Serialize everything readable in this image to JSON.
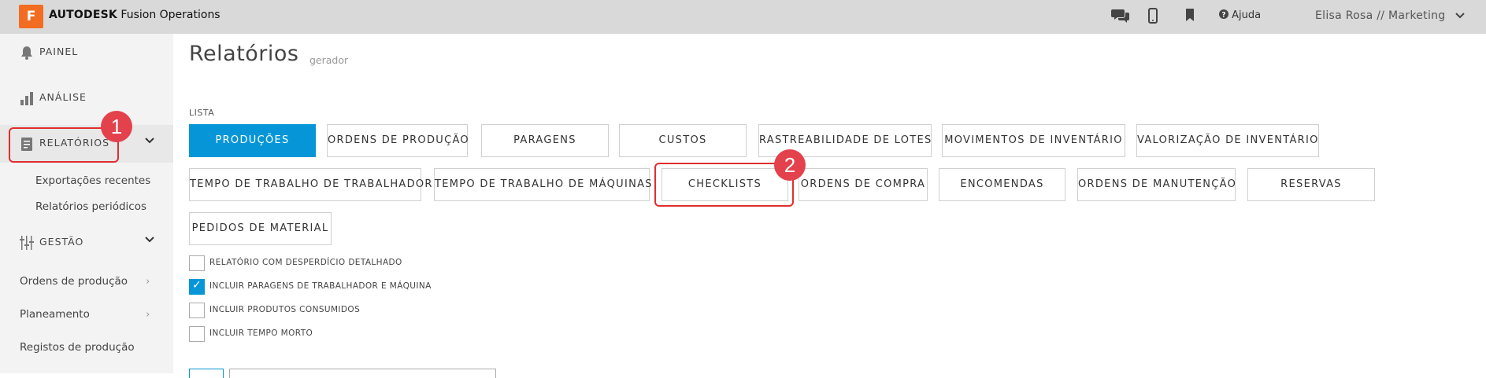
{
  "header": {
    "logo_letter": "F",
    "brand_bold": "AUTODESK",
    "brand_rest": "Fusion Operations",
    "help_label": "Ajuda",
    "user_label": "Elisa Rosa // Marketing"
  },
  "sidebar": {
    "nav": {
      "painel": "PAINEL",
      "analise": "ANÁLISE",
      "relatorios": "RELATÓRIOS",
      "gestao": "GESTÃO"
    },
    "relatorios_sub": {
      "recent": "Exportações recentes",
      "periodic": "Relatórios periódicos"
    },
    "gestao_sub": {
      "orders": "Ordens de produção",
      "planning": "Planeamento",
      "records": "Registos de produção"
    }
  },
  "page": {
    "title": "Relatórios",
    "subtitle": "gerador",
    "list_label": "LISTA"
  },
  "report_buttons": {
    "producoes": "PRODUÇÕES",
    "ordens_producao": "ORDENS DE PRODUÇÃO",
    "paragens": "PARAGENS",
    "custos": "CUSTOS",
    "rastreabilidade": "RASTREABILIDADE DE LOTES",
    "movimentos": "MOVIMENTOS DE INVENTÁRIO",
    "valorizacao": "VALORIZAÇÃO DE INVENTÁRIO",
    "tempo_trabalhador": "TEMPO DE TRABALHO DE TRABALHADOR",
    "tempo_maquinas": "TEMPO DE TRABALHO DE MÁQUINAS",
    "checklists": "CHECKLISTS",
    "ordens_compra": "ORDENS DE COMPRA",
    "encomendas": "ENCOMENDAS",
    "ordens_manutencao": "ORDENS DE MANUTENÇÃO",
    "reservas": "RESERVAS",
    "pedidos_material": "PEDIDOS DE MATERIAL"
  },
  "options": {
    "desperdicio": "RELATÓRIO COM DESPERDÍCIO DETALHADO",
    "paragens": "INCLUIR PARAGENS DE TRABALHADOR E MÁQUINA",
    "consumidos": "INCLUIR PRODUTOS CONSUMIDOS",
    "tempo_morto": "INCLUIR TEMPO MORTO"
  },
  "option_states": {
    "desperdicio": false,
    "paragens": true,
    "consumidos": false,
    "tempo_morto": false
  },
  "annotations": {
    "step1": "1",
    "step2": "2"
  },
  "colors": {
    "accent": "#0696d7",
    "brand": "#f26d21",
    "callout": "#e02e2e"
  }
}
